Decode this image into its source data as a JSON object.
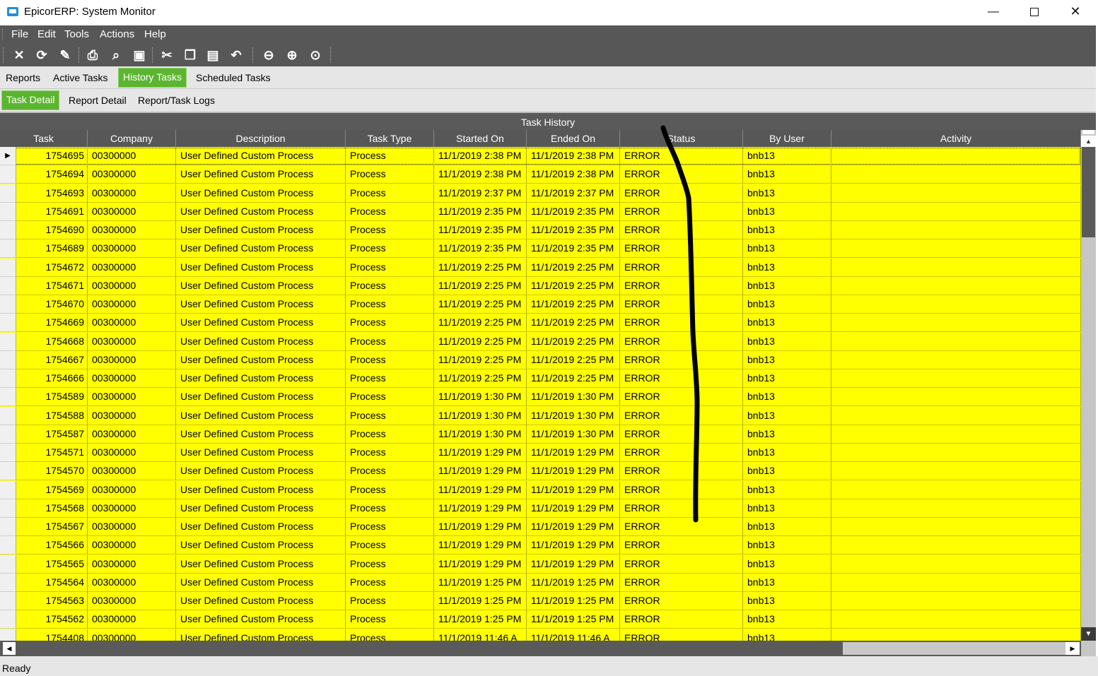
{
  "window": {
    "title": "EpicorERP: System Monitor",
    "controls": {
      "minimize": "—",
      "close": "✕"
    }
  },
  "menu": [
    "File",
    "Edit",
    "Tools",
    "Actions",
    "Help"
  ],
  "toolbar_icons": [
    "delete-icon",
    "refresh-icon",
    "clear-icon",
    "print-icon",
    "print-preview-icon",
    "save-icon",
    "cut-icon",
    "copy-icon",
    "paste-icon",
    "undo-icon",
    "back-icon",
    "forward-icon",
    "home-icon"
  ],
  "tabs": [
    "Reports",
    "Active Tasks",
    "History Tasks",
    "Scheduled Tasks"
  ],
  "active_tab": "History Tasks",
  "subtabs": [
    "Task Detail",
    "Report Detail",
    "Report/Task Logs"
  ],
  "active_subtab": "Task Detail",
  "grid": {
    "title": "Task History",
    "columns": [
      "Task",
      "Company",
      "Description",
      "Task Type",
      "Started On",
      "Ended On",
      "Status",
      "By User",
      "Activity"
    ],
    "rows": [
      [
        "1754695",
        "00300000",
        "User Defined Custom Process",
        "Process",
        "11/1/2019 2:38 PM",
        "11/1/2019 2:38 PM",
        "ERROR",
        "bnb13",
        ""
      ],
      [
        "1754694",
        "00300000",
        "User Defined Custom Process",
        "Process",
        "11/1/2019 2:38 PM",
        "11/1/2019 2:38 PM",
        "ERROR",
        "bnb13",
        ""
      ],
      [
        "1754693",
        "00300000",
        "User Defined Custom Process",
        "Process",
        "11/1/2019 2:37 PM",
        "11/1/2019 2:37 PM",
        "ERROR",
        "bnb13",
        ""
      ],
      [
        "1754691",
        "00300000",
        "User Defined Custom Process",
        "Process",
        "11/1/2019 2:35 PM",
        "11/1/2019 2:35 PM",
        "ERROR",
        "bnb13",
        ""
      ],
      [
        "1754690",
        "00300000",
        "User Defined Custom Process",
        "Process",
        "11/1/2019 2:35 PM",
        "11/1/2019 2:35 PM",
        "ERROR",
        "bnb13",
        ""
      ],
      [
        "1754689",
        "00300000",
        "User Defined Custom Process",
        "Process",
        "11/1/2019 2:35 PM",
        "11/1/2019 2:35 PM",
        "ERROR",
        "bnb13",
        ""
      ],
      [
        "1754672",
        "00300000",
        "User Defined Custom Process",
        "Process",
        "11/1/2019 2:25 PM",
        "11/1/2019 2:25 PM",
        "ERROR",
        "bnb13",
        ""
      ],
      [
        "1754671",
        "00300000",
        "User Defined Custom Process",
        "Process",
        "11/1/2019 2:25 PM",
        "11/1/2019 2:25 PM",
        "ERROR",
        "bnb13",
        ""
      ],
      [
        "1754670",
        "00300000",
        "User Defined Custom Process",
        "Process",
        "11/1/2019 2:25 PM",
        "11/1/2019 2:25 PM",
        "ERROR",
        "bnb13",
        ""
      ],
      [
        "1754669",
        "00300000",
        "User Defined Custom Process",
        "Process",
        "11/1/2019 2:25 PM",
        "11/1/2019 2:25 PM",
        "ERROR",
        "bnb13",
        ""
      ],
      [
        "1754668",
        "00300000",
        "User Defined Custom Process",
        "Process",
        "11/1/2019 2:25 PM",
        "11/1/2019 2:25 PM",
        "ERROR",
        "bnb13",
        ""
      ],
      [
        "1754667",
        "00300000",
        "User Defined Custom Process",
        "Process",
        "11/1/2019 2:25 PM",
        "11/1/2019 2:25 PM",
        "ERROR",
        "bnb13",
        ""
      ],
      [
        "1754666",
        "00300000",
        "User Defined Custom Process",
        "Process",
        "11/1/2019 2:25 PM",
        "11/1/2019 2:25 PM",
        "ERROR",
        "bnb13",
        ""
      ],
      [
        "1754589",
        "00300000",
        "User Defined Custom Process",
        "Process",
        "11/1/2019 1:30 PM",
        "11/1/2019 1:30 PM",
        "ERROR",
        "bnb13",
        ""
      ],
      [
        "1754588",
        "00300000",
        "User Defined Custom Process",
        "Process",
        "11/1/2019 1:30 PM",
        "11/1/2019 1:30 PM",
        "ERROR",
        "bnb13",
        ""
      ],
      [
        "1754587",
        "00300000",
        "User Defined Custom Process",
        "Process",
        "11/1/2019 1:30 PM",
        "11/1/2019 1:30 PM",
        "ERROR",
        "bnb13",
        ""
      ],
      [
        "1754571",
        "00300000",
        "User Defined Custom Process",
        "Process",
        "11/1/2019 1:29 PM",
        "11/1/2019 1:29 PM",
        "ERROR",
        "bnb13",
        ""
      ],
      [
        "1754570",
        "00300000",
        "User Defined Custom Process",
        "Process",
        "11/1/2019 1:29 PM",
        "11/1/2019 1:29 PM",
        "ERROR",
        "bnb13",
        ""
      ],
      [
        "1754569",
        "00300000",
        "User Defined Custom Process",
        "Process",
        "11/1/2019 1:29 PM",
        "11/1/2019 1:29 PM",
        "ERROR",
        "bnb13",
        ""
      ],
      [
        "1754568",
        "00300000",
        "User Defined Custom Process",
        "Process",
        "11/1/2019 1:29 PM",
        "11/1/2019 1:29 PM",
        "ERROR",
        "bnb13",
        ""
      ],
      [
        "1754567",
        "00300000",
        "User Defined Custom Process",
        "Process",
        "11/1/2019 1:29 PM",
        "11/1/2019 1:29 PM",
        "ERROR",
        "bnb13",
        ""
      ],
      [
        "1754566",
        "00300000",
        "User Defined Custom Process",
        "Process",
        "11/1/2019 1:29 PM",
        "11/1/2019 1:29 PM",
        "ERROR",
        "bnb13",
        ""
      ],
      [
        "1754565",
        "00300000",
        "User Defined Custom Process",
        "Process",
        "11/1/2019 1:29 PM",
        "11/1/2019 1:29 PM",
        "ERROR",
        "bnb13",
        ""
      ],
      [
        "1754564",
        "00300000",
        "User Defined Custom Process",
        "Process",
        "11/1/2019 1:25 PM",
        "11/1/2019 1:25 PM",
        "ERROR",
        "bnb13",
        ""
      ],
      [
        "1754563",
        "00300000",
        "User Defined Custom Process",
        "Process",
        "11/1/2019 1:25 PM",
        "11/1/2019 1:25 PM",
        "ERROR",
        "bnb13",
        ""
      ],
      [
        "1754562",
        "00300000",
        "User Defined Custom Process",
        "Process",
        "11/1/2019 1:25 PM",
        "11/1/2019 1:25 PM",
        "ERROR",
        "bnb13",
        ""
      ],
      [
        "1754408",
        "00300000",
        "User Defined Custom Process",
        "Process",
        "11/1/2019 11:46 A",
        "11/1/2019 11:46 A",
        "ERROR",
        "bnb13",
        ""
      ]
    ]
  },
  "status_bar": {
    "text": "Ready"
  },
  "colors": {
    "row_highlight": "#ffff00",
    "active_tab": "#5cb531",
    "chrome_dark": "#575757"
  }
}
